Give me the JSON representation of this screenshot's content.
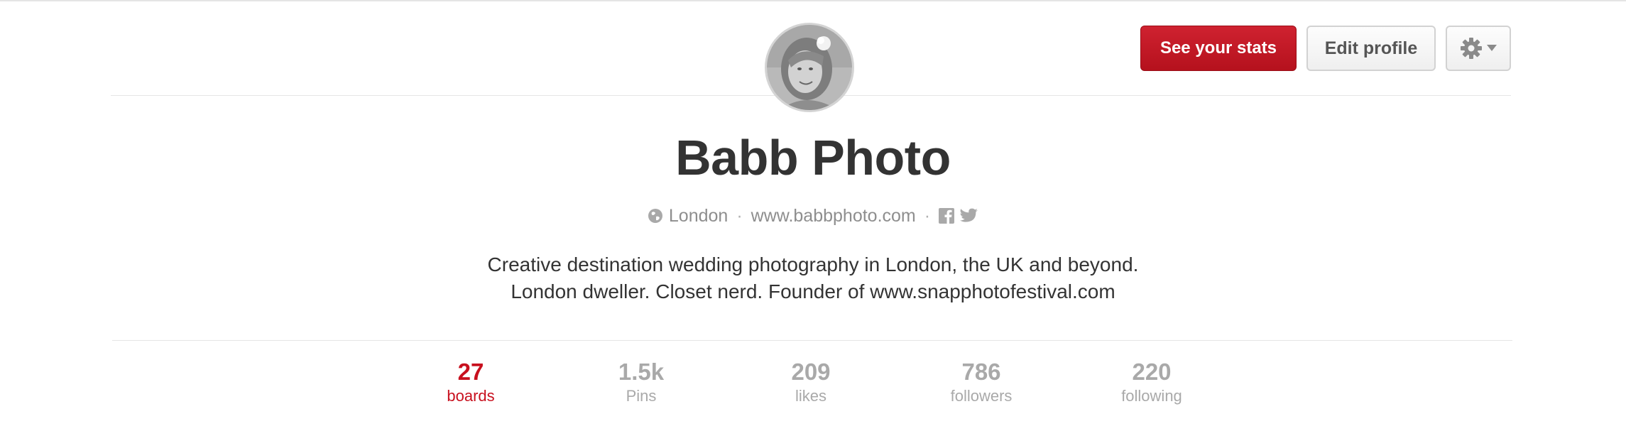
{
  "header": {
    "stats_button": "See your stats",
    "edit_button": "Edit profile",
    "settings_icon": "gear-icon"
  },
  "profile": {
    "name": "Babb Photo",
    "location": "London",
    "separator": "·",
    "website": "www.babbphoto.com",
    "social_icons": [
      "facebook-icon",
      "twitter-icon"
    ],
    "bio_lines": [
      "Creative destination wedding photography in London, the UK and beyond.",
      "London dweller. Closet nerd. Founder of www.snapphotofestival.com"
    ]
  },
  "stats": [
    {
      "value": "27",
      "label": "boards",
      "active": true
    },
    {
      "value": "1.5k",
      "label": "Pins",
      "active": false
    },
    {
      "value": "209",
      "label": "likes",
      "active": false
    },
    {
      "value": "786",
      "label": "followers",
      "active": false
    },
    {
      "value": "220",
      "label": "following",
      "active": false
    }
  ],
  "colors": {
    "accent": "#c8101e",
    "muted": "#a9a9a9",
    "text": "#333333"
  }
}
